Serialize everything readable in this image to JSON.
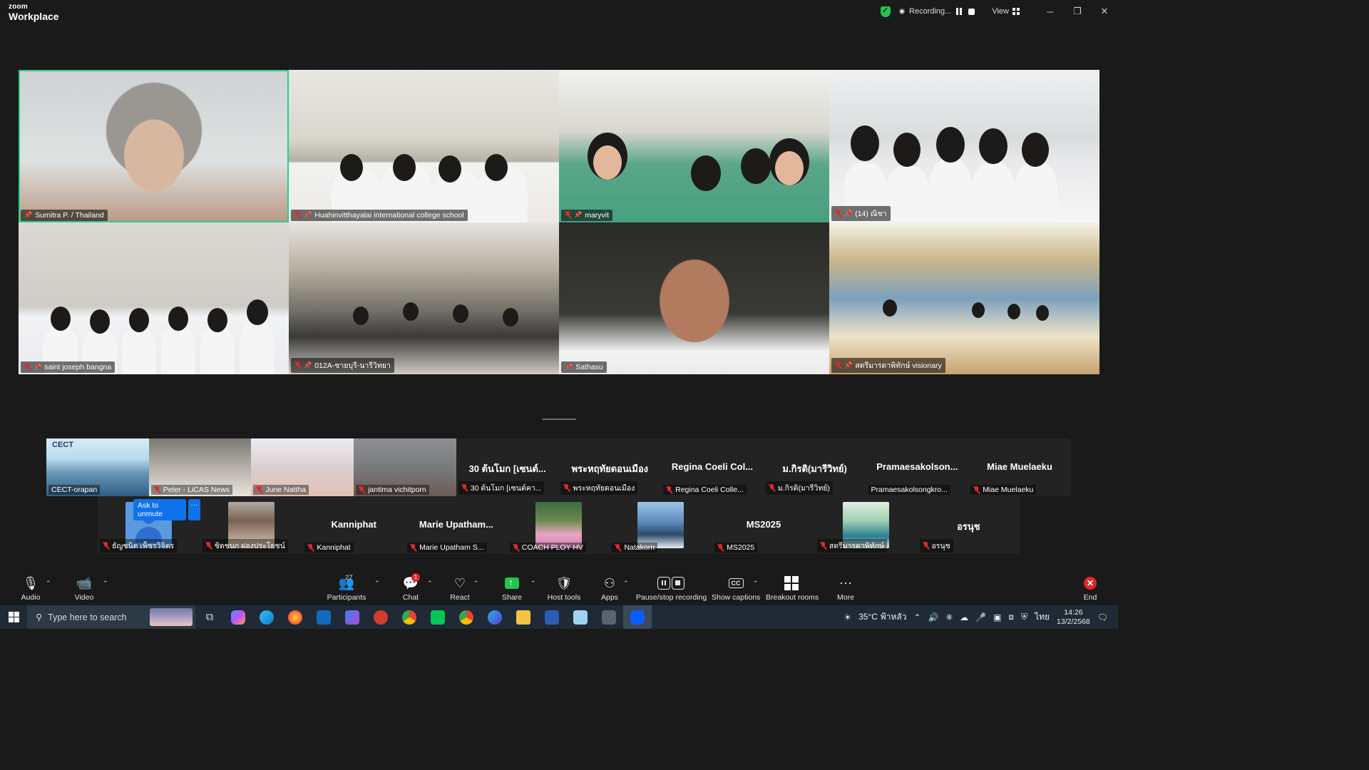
{
  "titlebar": {
    "brand_top": "zoom",
    "brand_bottom": "Workplace",
    "recording_label": "Recording...",
    "view_label": "View",
    "minimize": "─",
    "maximize": "❐",
    "close": "✕"
  },
  "gallery": {
    "tiles": [
      {
        "name": "Sumitra P. / Thailand",
        "muted": false,
        "active": true
      },
      {
        "name": "Huahinvitthayalai international college school",
        "muted": true
      },
      {
        "name": "maryvit",
        "muted": true
      },
      {
        "name": "(14) ณิชา",
        "muted": true
      },
      {
        "name": "saint joseph bangna",
        "muted": true
      },
      {
        "name": "012A-ชายบุรี-นารีวิทยา",
        "muted": true
      },
      {
        "name": "Sathasu",
        "muted": false
      },
      {
        "name": "สตรีมารดาพิทักษ์ visionary",
        "muted": true
      }
    ]
  },
  "strip_row1": [
    {
      "name": "CECT-orapan",
      "big": "",
      "logo": "CECT",
      "muted": false
    },
    {
      "name": "Peter - LiCAS News",
      "big": "",
      "muted": true
    },
    {
      "name": "June Nattha",
      "big": "",
      "muted": true
    },
    {
      "name": "jantima vichitporn",
      "big": "",
      "muted": true
    },
    {
      "name": "30 ต้นโมก [เซนต์คา...",
      "big": "30 ต้นโมก [เซนต์...",
      "muted": true
    },
    {
      "name": "พระหฤทัยดอนเมือง",
      "big": "พระหฤทัยดอนเมือง",
      "muted": true
    },
    {
      "name": "Regina Coeli Colle...",
      "big": "Regina Coeli Col...",
      "muted": true
    },
    {
      "name": "ม.กิรติ(มารีวิทย์)",
      "big": "ม.กิรติ(มารีวิทย์)",
      "muted": true
    },
    {
      "name": "Pramaesakolsongkro...",
      "big": "Pramaesakolson...",
      "muted": false
    },
    {
      "name": "Miae Muelaeku",
      "big": "Miae Muelaeku",
      "muted": true
    }
  ],
  "strip_row2": [
    {
      "name": "ธัญชนิต เพ็ชรวิจิตร",
      "big": "",
      "muted": true
    },
    {
      "name": "ชิดชนก ผ่องประโยชน์",
      "big": "",
      "muted": true
    },
    {
      "name": "Kanniphat",
      "big": "Kanniphat",
      "muted": true
    },
    {
      "name": "Marie Upatham S...",
      "big": "Marie Upatham...",
      "muted": true
    },
    {
      "name": "COACH PLOY HV",
      "big": "",
      "muted": true
    },
    {
      "name": "Natakorn",
      "big": "",
      "muted": true
    },
    {
      "name": "MS2025",
      "big": "MS2025",
      "muted": true
    },
    {
      "name": "สตรีมารดาพิทักษ์",
      "big": "",
      "muted": true
    },
    {
      "name": "อรนุช",
      "big": "อรนุช",
      "muted": true
    }
  ],
  "unmute": {
    "label": "Ask to unmute",
    "more": "···"
  },
  "toolbar": {
    "audio": "Audio",
    "video": "Video",
    "participants": "Participants",
    "participants_count": "27",
    "chat": "Chat",
    "chat_badge": "1",
    "react": "React",
    "share": "Share",
    "host_tools": "Host tools",
    "apps": "Apps",
    "pause_stop": "Pause/stop recording",
    "captions": "Show captions",
    "breakout": "Breakout rooms",
    "more": "More",
    "end": "End"
  },
  "taskbar": {
    "search_placeholder": "Type here to search",
    "weather": "35°C ฟ้าหลัว",
    "lang": "ไทย",
    "time": "14:26",
    "date": "13/2/2568"
  }
}
